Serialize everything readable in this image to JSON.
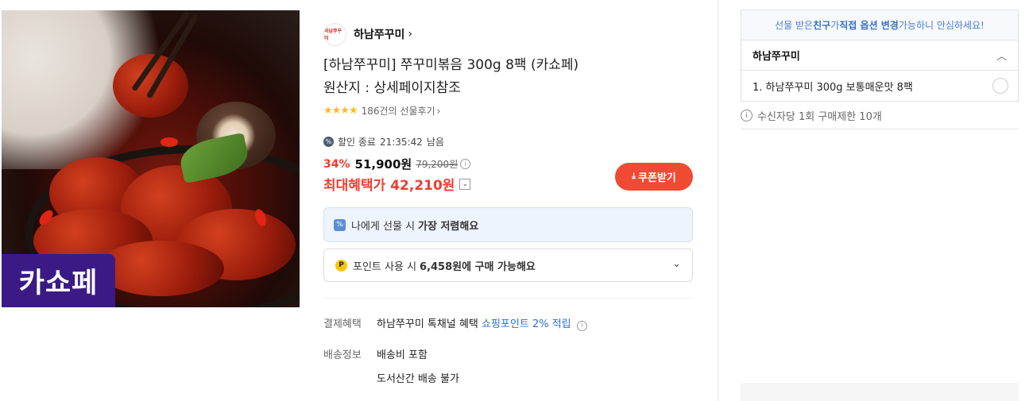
{
  "product_image": {
    "badge_text": "카쇼페",
    "alt_description": "쭈꾸미볶음"
  },
  "brand": {
    "logo_text": "하남쭈꾸미",
    "name": "하남쭈꾸미",
    "chevron": "›"
  },
  "product": {
    "title": "[하남쭈꾸미] 쭈꾸미볶음 300g 8팩 (카쇼페)",
    "origin": "원산지 : 상세페이지참조"
  },
  "review": {
    "stars": "★★★★",
    "text": "186건의 선물후기",
    "chevron": "›"
  },
  "timer": {
    "label": "할인 종료",
    "time": "21:35:42",
    "suffix": "남음"
  },
  "price": {
    "discount": "34%",
    "sale_price": "51,900원",
    "original_price": "79,200원",
    "max_label": "최대혜택가",
    "max_price": "42,210원"
  },
  "coupon_button": {
    "label": "쿠폰받기"
  },
  "gift_banner": {
    "text": "나에게 선물 시",
    "bold": "가장 저렴해요"
  },
  "points": {
    "icon": "P",
    "text": "포인트 사용 시",
    "bold": "6,458원에 구매 가능해요"
  },
  "benefits": {
    "label": "결제혜택",
    "value_prefix": "하남쭈꾸미 톡채널 혜택",
    "value_link": "쇼핑포인트 2% 적립"
  },
  "shipping": {
    "label": "배송정보",
    "line1": "배송비 포함",
    "line2": "도서산간 배송 불가"
  },
  "right_panel": {
    "notice": {
      "part1": "선물 받은 ",
      "bold1": "친구",
      "part2": "가 ",
      "bold2": "직접 옵션 변경",
      "part3": " 가능하니 안심하세요!"
    },
    "option_group": {
      "name": "하남쭈꾸미",
      "items": [
        {
          "label": "1. 하남쭈꾸미 300g 보통매운맛 8팩",
          "selected": false
        }
      ]
    },
    "limit": {
      "icon": "i",
      "text": "수신자당 1회 구매제한 10개"
    }
  },
  "colors": {
    "accent_red": "#f03c2e",
    "coupon_bg": "#f04a33",
    "link_blue": "#2f6fd0",
    "badge_purple": "#3b1a86",
    "star": "#ffbf00"
  }
}
